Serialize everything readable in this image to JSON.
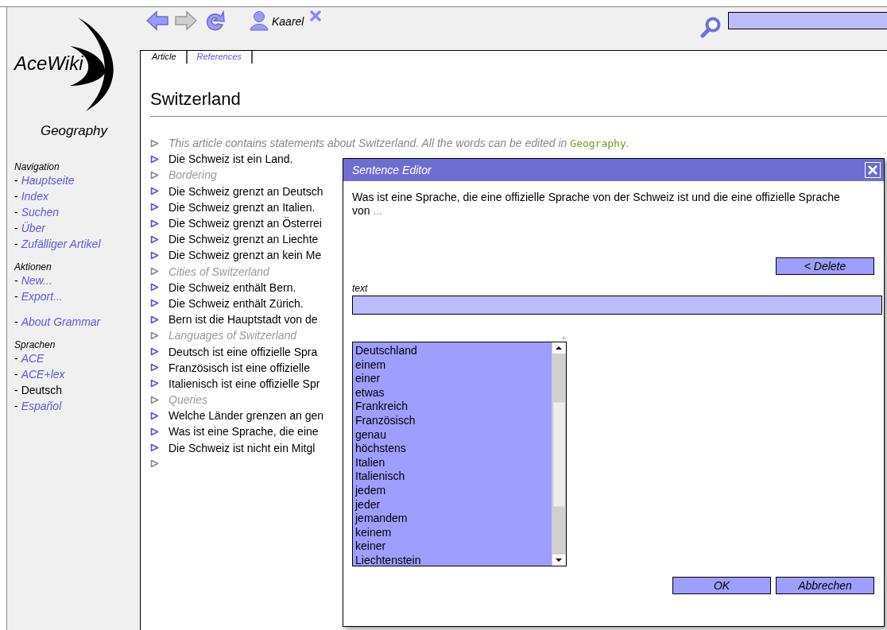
{
  "toolbar": {
    "back_disabled": false,
    "forward_disabled": true,
    "user": "Kaarel"
  },
  "sidebar": {
    "wiki": "AceWiki",
    "ontology": "Geography",
    "sections": [
      {
        "title": "Navigation",
        "links": [
          {
            "bullet": "-",
            "label": "Hauptseite",
            "selected": false
          },
          {
            "bullet": "-",
            "label": "Index",
            "selected": false
          },
          {
            "bullet": "-",
            "label": "Suchen",
            "selected": false
          },
          {
            "bullet": "-",
            "label": "Über",
            "selected": false
          },
          {
            "bullet": "-",
            "label": "Zufälliger Artikel",
            "selected": false
          }
        ]
      },
      {
        "title": "Aktionen",
        "links": [
          {
            "bullet": "-",
            "label": "New...",
            "selected": false
          },
          {
            "bullet": "-",
            "label": "Export...",
            "selected": false
          }
        ]
      },
      {
        "links": [
          {
            "bullet": "-",
            "label": "About Grammar",
            "selected": false
          }
        ]
      },
      {
        "title": "Sprachen",
        "links": [
          {
            "bullet": "-",
            "label": "ACE",
            "selected": false
          },
          {
            "bullet": "-",
            "label": "ACE+lex",
            "selected": false
          },
          {
            "bullet": "-",
            "label": "Deutsch",
            "selected": true
          },
          {
            "bullet": "-",
            "label": "Español",
            "selected": false
          }
        ]
      }
    ]
  },
  "tabs": [
    {
      "label": "Article",
      "selected": true
    },
    {
      "label": "References",
      "selected": false
    }
  ],
  "article": {
    "title": "Switzerland",
    "statements": [
      {
        "kind": "comment",
        "text": "This article contains statements about Switzerland. All the words can be edited in",
        "link": "Geography",
        "tail": "."
      },
      {
        "kind": "sentence",
        "text": "Die Schweiz ist ein Land."
      },
      {
        "kind": "heading",
        "text": "Bordering"
      },
      {
        "kind": "sentence",
        "text": "Die Schweiz grenzt an Deutsch"
      },
      {
        "kind": "sentence",
        "text": "Die Schweiz grenzt an Italien."
      },
      {
        "kind": "sentence",
        "text": "Die Schweiz grenzt an Österrei"
      },
      {
        "kind": "sentence",
        "text": "Die Schweiz grenzt an Liechte"
      },
      {
        "kind": "sentence",
        "text": "Die Schweiz grenzt an kein Me"
      },
      {
        "kind": "heading",
        "text": "Cities of Switzerland"
      },
      {
        "kind": "sentence",
        "text": "Die Schweiz enthält Bern."
      },
      {
        "kind": "sentence",
        "text": "Die Schweiz enthält Zürich."
      },
      {
        "kind": "sentence",
        "text": "Bern ist die Hauptstadt von de"
      },
      {
        "kind": "heading",
        "text": "Languages of Switzerland"
      },
      {
        "kind": "sentence",
        "text": "Deutsch ist eine offizielle Spra"
      },
      {
        "kind": "sentence",
        "text": "Französisch ist eine offizielle"
      },
      {
        "kind": "sentence",
        "text": "Italienisch ist eine offizielle Spr"
      },
      {
        "kind": "heading",
        "text": "Queries"
      },
      {
        "kind": "sentence",
        "text": "Welche Länder grenzen an gen"
      },
      {
        "kind": "sentence",
        "text": "Was ist eine Sprache, die eine"
      },
      {
        "kind": "sentence",
        "text": "Die Schweiz ist nicht ein Mitgl"
      },
      {
        "kind": "new"
      }
    ]
  },
  "dialog": {
    "title": "Sentence Editor",
    "sentence": "Was ist eine Sprache, die eine offizielle Sprache von der Schweiz ist und die eine offizielle Sprache von",
    "ellipsis": "...",
    "delete": "< Delete",
    "field_label": "text",
    "plus": "+",
    "options": [
      "Deutschland",
      "einem",
      "einer",
      "etwas",
      "Frankreich",
      "Französisch",
      "genau",
      "höchstens",
      "Italien",
      "Italienisch",
      "jedem",
      "jeder",
      "jemandem",
      "keinem",
      "keiner",
      "Liechtenstein"
    ],
    "buttons": [
      "OK",
      "Abbrechen"
    ]
  }
}
